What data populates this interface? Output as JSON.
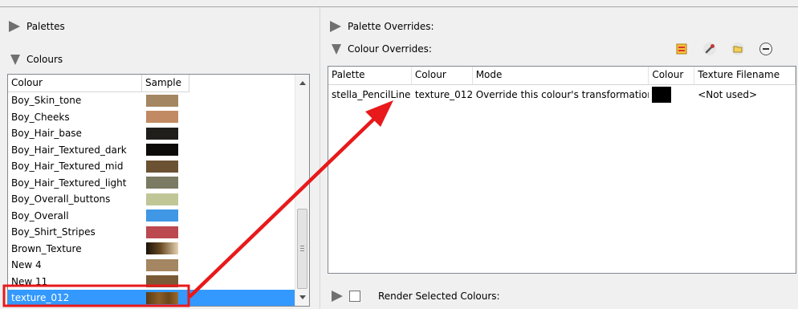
{
  "left": {
    "palettes_label": "Palettes",
    "colours_label": "Colours",
    "list": {
      "headers": [
        "Colour",
        "Sample"
      ],
      "rows": [
        {
          "name": "Boy_Skin_tone",
          "color": "#a58662"
        },
        {
          "name": "Boy_Cheeks",
          "color": "#c28a62"
        },
        {
          "name": "Boy_Hair_base",
          "color": "#1f1e1a"
        },
        {
          "name": "Boy_Hair_Textured_dark",
          "color": "#0c0b09"
        },
        {
          "name": "Boy_Hair_Textured_mid",
          "color": "#6b5233"
        },
        {
          "name": "Boy_Hair_Textured_light",
          "color": "#7b7a62"
        },
        {
          "name": "Boy_Overall_buttons",
          "color": "#c1c697"
        },
        {
          "name": "Boy_Overall",
          "color": "#3f97e6"
        },
        {
          "name": "Boy_Shirt_Stripes",
          "color": "#bb494f"
        },
        {
          "name": "Brown_Texture",
          "color": "linear-gradient(90deg,#1b1208,#6a4a24 45%,#e4d1b0)"
        },
        {
          "name": "New 4",
          "color": "#a58662"
        },
        {
          "name": "New 11",
          "color": "#7a5a36"
        },
        {
          "name": "texture_012",
          "color": "linear-gradient(90deg,#5a3a14,#8a5e28 40%,#6b4618 70%,#9b6a2e)"
        }
      ]
    }
  },
  "right": {
    "palette_overrides_label": "Palette Overrides:",
    "colour_overrides_label": "Colour Overrides:",
    "toolbar_icons": [
      "colour-swatch-icon",
      "eyedropper-icon",
      "folder-icon",
      "remove-icon"
    ],
    "grid": {
      "headers": [
        "Palette",
        "Colour",
        "Mode",
        "Colour",
        "Texture Filename"
      ],
      "rows": [
        {
          "palette": "stella_PencilLine",
          "colour": "texture_012",
          "mode": "Override this colour's transformation",
          "swatch": "#000000",
          "texture": "<Not used>"
        }
      ]
    },
    "render_selected_label": "Render Selected Colours:"
  },
  "colors": {
    "selection": "#3399ff",
    "annotation": "#e8191b"
  }
}
